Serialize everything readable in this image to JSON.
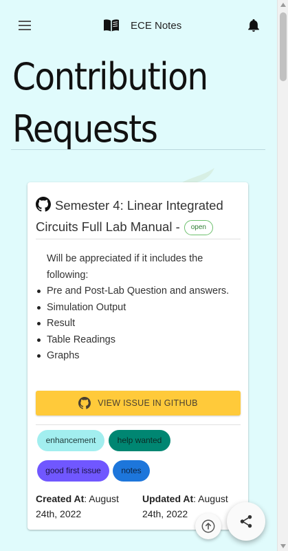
{
  "app": {
    "title": "ECE Notes"
  },
  "page": {
    "heading": "Contribution Requests"
  },
  "issue": {
    "title": "Semester 4: Linear Integrated Circuits Full Lab Manual -",
    "status": "open",
    "intro": "Will be appreciated if it includes the following:",
    "items": [
      "Pre and Post-Lab Question and answers.",
      "Simulation Output",
      "Result",
      "Table Readings",
      "Graphs"
    ],
    "button_label": "VIEW ISSUE IN GITHUB",
    "labels": [
      {
        "text": "enhancement",
        "bg": "#a2eeef",
        "color": "#1f3a3a"
      },
      {
        "text": "help wanted",
        "bg": "#008672",
        "color": "#0b2a24"
      },
      {
        "text": "good first issue",
        "bg": "#7057ff",
        "color": "#1c1340"
      },
      {
        "text": "notes",
        "bg": "#1d76db",
        "color": "#0c2340"
      }
    ],
    "created_label": "Created At",
    "created_value": ": August 24th, 2022",
    "updated_label": "Updated At",
    "updated_value": ": August 24th, 2022"
  },
  "icons": {
    "menu": "hamburger-icon",
    "brand": "open-book-icon",
    "notifications": "bell-icon",
    "github": "github-icon",
    "scroll_top": "arrow-up-circle-icon",
    "share": "share-icon"
  },
  "colors": {
    "background": "#e0fbfc",
    "primary_button": "#ffca3a",
    "status_open": "#2e7d32"
  }
}
